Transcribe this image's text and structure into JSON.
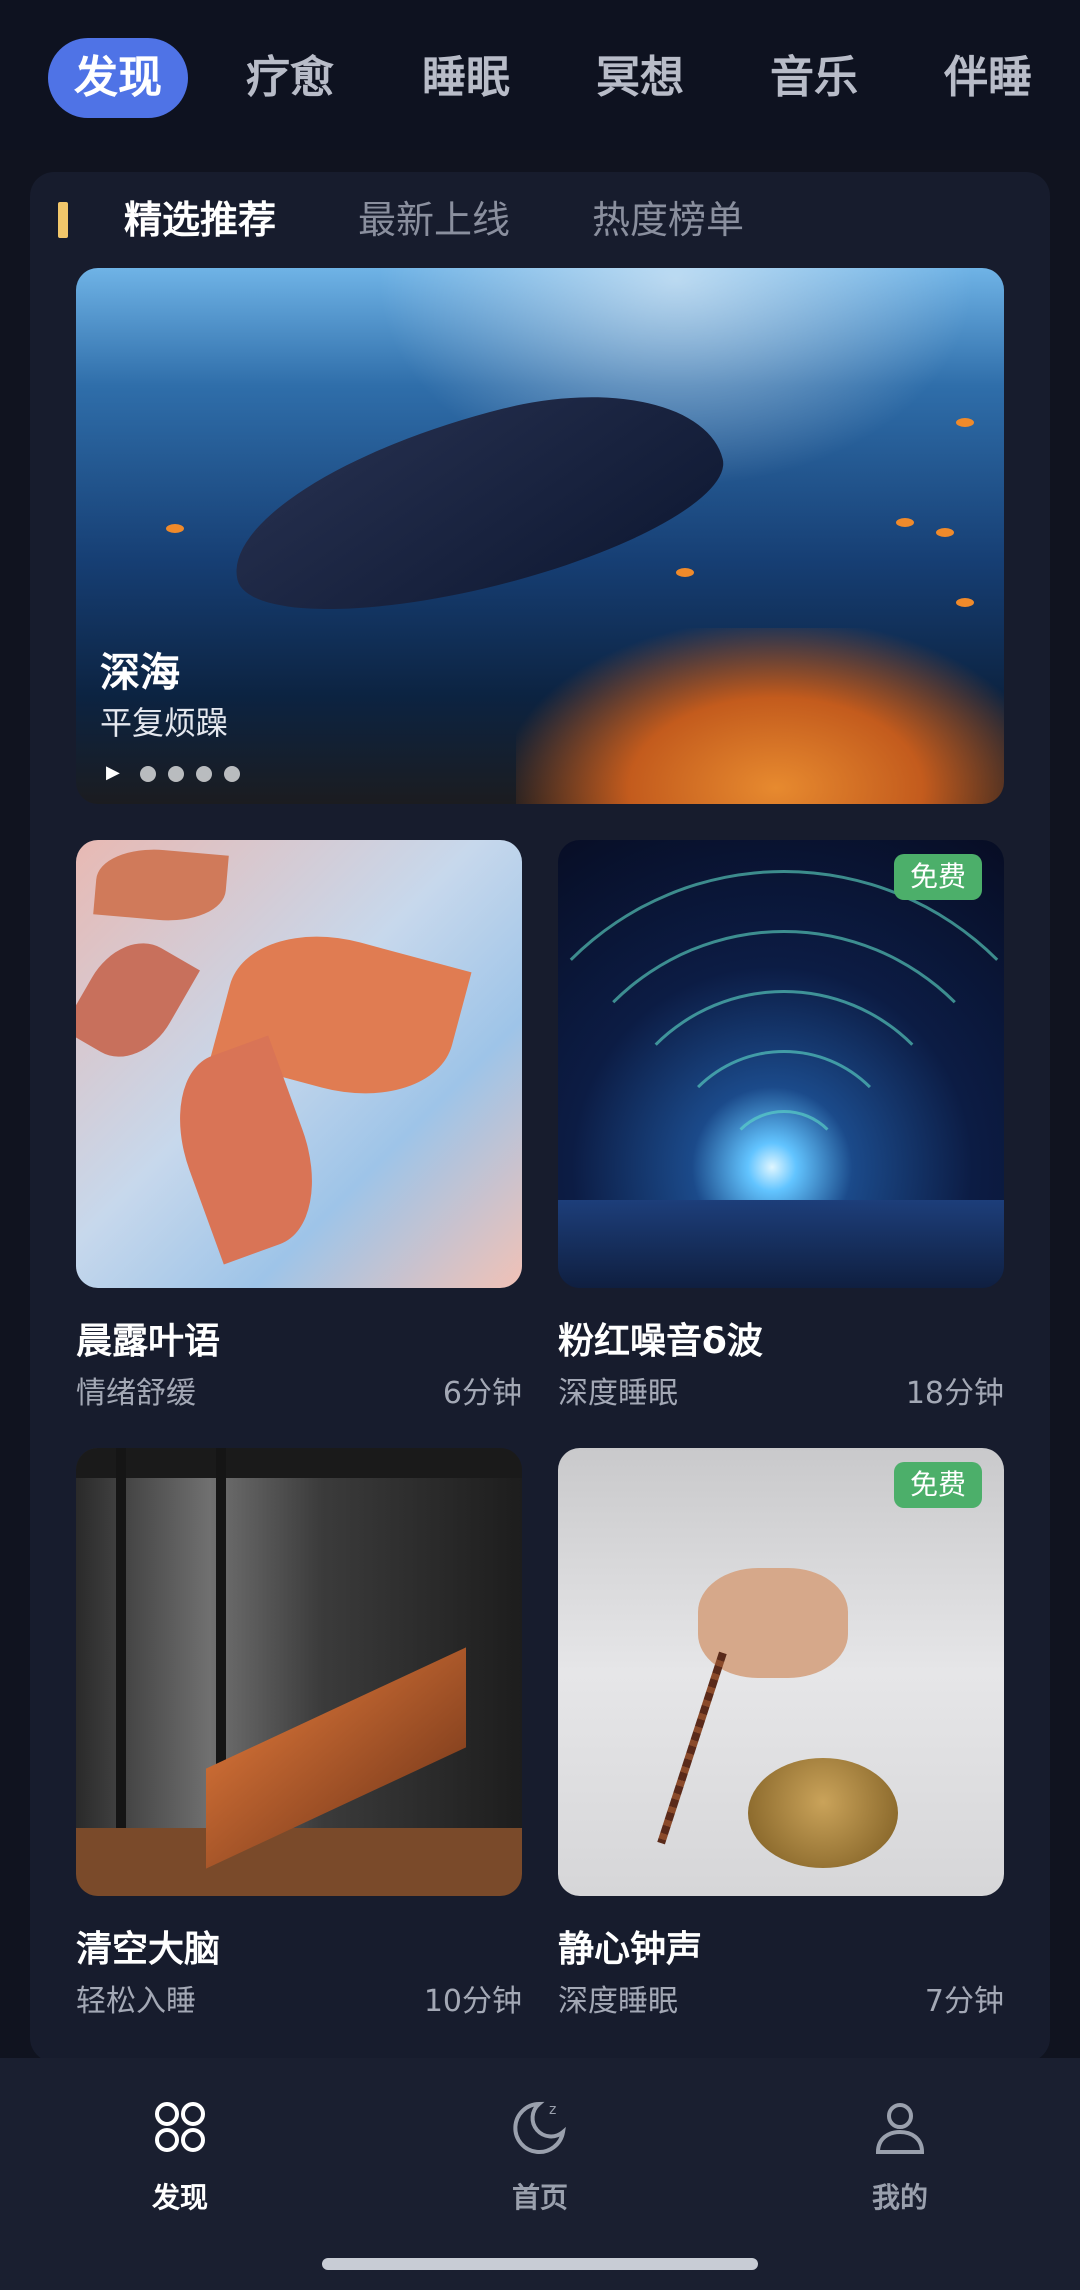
{
  "top_tabs": [
    {
      "label": "发现",
      "active": true
    },
    {
      "label": "疗愈",
      "active": false
    },
    {
      "label": "睡眠",
      "active": false
    },
    {
      "label": "冥想",
      "active": false
    },
    {
      "label": "音乐",
      "active": false
    },
    {
      "label": "伴睡",
      "active": false
    }
  ],
  "sub_tabs": [
    {
      "label": "精选推荐",
      "active": true
    },
    {
      "label": "最新上线",
      "active": false
    },
    {
      "label": "热度榜单",
      "active": false
    }
  ],
  "banner": {
    "title": "深海",
    "subtitle": "平复烦躁",
    "page_count": 5,
    "current_page": 1
  },
  "cards": [
    {
      "title": "晨露叶语",
      "category": "情绪舒缓",
      "duration": "6分钟",
      "badge": ""
    },
    {
      "title": "粉红噪音δ波",
      "category": "深度睡眠",
      "duration": "18分钟",
      "badge": "免费"
    },
    {
      "title": "清空大脑",
      "category": "轻松入睡",
      "duration": "10分钟",
      "badge": ""
    },
    {
      "title": "静心钟声",
      "category": "深度睡眠",
      "duration": "7分钟",
      "badge": "免费"
    }
  ],
  "bottom_nav": [
    {
      "label": "发现",
      "icon": "grid-icon",
      "active": true
    },
    {
      "label": "首页",
      "icon": "moon-icon",
      "active": false
    },
    {
      "label": "我的",
      "icon": "person-icon",
      "active": false
    }
  ],
  "colors": {
    "accent": "#4f73e6",
    "badge": "#4caf6a",
    "background": "#10131f"
  }
}
